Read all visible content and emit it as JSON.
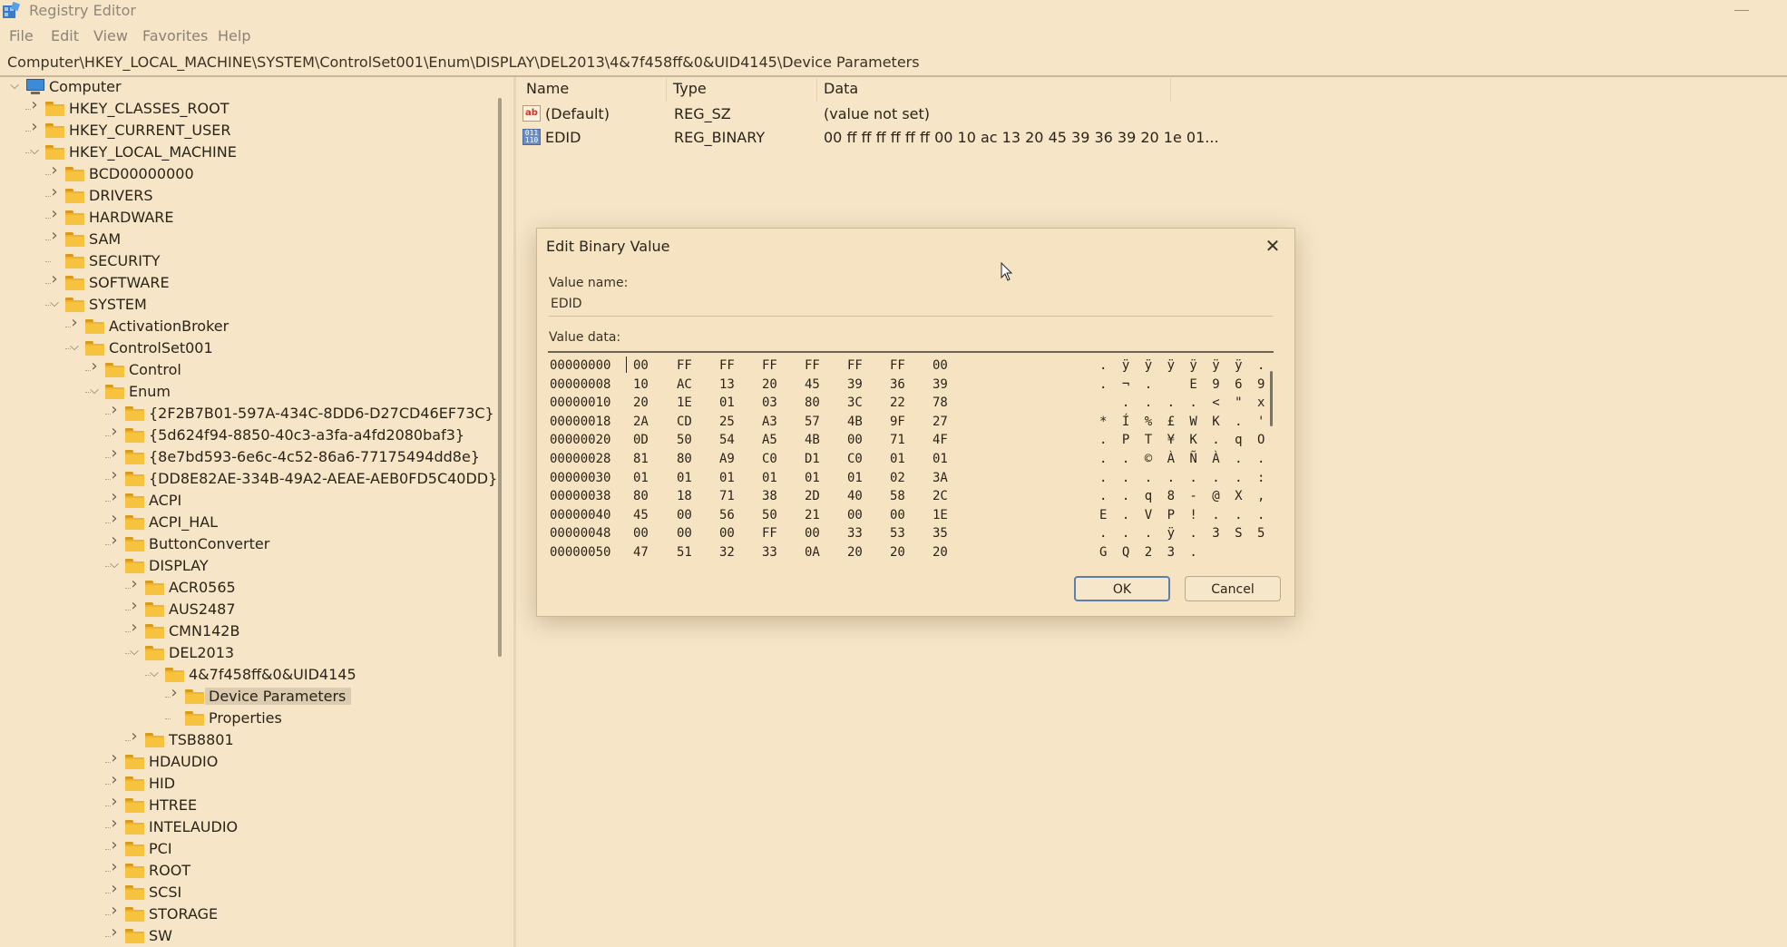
{
  "window": {
    "title": "Registry Editor",
    "app_icon": "registry-icon"
  },
  "menu": [
    "File",
    "Edit",
    "View",
    "Favorites",
    "Help"
  ],
  "address": "Computer\\HKEY_LOCAL_MACHINE\\SYSTEM\\ControlSet001\\Enum\\DISPLAY\\DEL2013\\4&7f458ff&0&UID4145\\Device Parameters",
  "tree": [
    {
      "label": "Computer",
      "level": 0,
      "state": "expanded",
      "icon": "computer-icon"
    },
    {
      "label": "HKEY_CLASSES_ROOT",
      "level": 1,
      "state": "collapsed"
    },
    {
      "label": "HKEY_CURRENT_USER",
      "level": 1,
      "state": "collapsed"
    },
    {
      "label": "HKEY_LOCAL_MACHINE",
      "level": 1,
      "state": "expanded"
    },
    {
      "label": "BCD00000000",
      "level": 2,
      "state": "collapsed"
    },
    {
      "label": "DRIVERS",
      "level": 2,
      "state": "collapsed"
    },
    {
      "label": "HARDWARE",
      "level": 2,
      "state": "collapsed"
    },
    {
      "label": "SAM",
      "level": 2,
      "state": "collapsed"
    },
    {
      "label": "SECURITY",
      "level": 2,
      "state": "leaf"
    },
    {
      "label": "SOFTWARE",
      "level": 2,
      "state": "collapsed"
    },
    {
      "label": "SYSTEM",
      "level": 2,
      "state": "expanded"
    },
    {
      "label": "ActivationBroker",
      "level": 3,
      "state": "collapsed"
    },
    {
      "label": "ControlSet001",
      "level": 3,
      "state": "expanded"
    },
    {
      "label": "Control",
      "level": 4,
      "state": "collapsed"
    },
    {
      "label": "Enum",
      "level": 4,
      "state": "expanded"
    },
    {
      "label": "{2F2B7B01-597A-434C-8DD6-D27CD46EF73C}",
      "level": 5,
      "state": "collapsed"
    },
    {
      "label": "{5d624f94-8850-40c3-a3fa-a4fd2080baf3}",
      "level": 5,
      "state": "collapsed"
    },
    {
      "label": "{8e7bd593-6e6c-4c52-86a6-77175494dd8e}",
      "level": 5,
      "state": "collapsed"
    },
    {
      "label": "{DD8E82AE-334B-49A2-AEAE-AEB0FD5C40DD}",
      "level": 5,
      "state": "collapsed"
    },
    {
      "label": "ACPI",
      "level": 5,
      "state": "collapsed"
    },
    {
      "label": "ACPI_HAL",
      "level": 5,
      "state": "collapsed"
    },
    {
      "label": "ButtonConverter",
      "level": 5,
      "state": "collapsed"
    },
    {
      "label": "DISPLAY",
      "level": 5,
      "state": "expanded"
    },
    {
      "label": "ACR0565",
      "level": 6,
      "state": "collapsed"
    },
    {
      "label": "AUS2487",
      "level": 6,
      "state": "collapsed"
    },
    {
      "label": "CMN142B",
      "level": 6,
      "state": "collapsed"
    },
    {
      "label": "DEL2013",
      "level": 6,
      "state": "expanded"
    },
    {
      "label": "4&7f458ff&0&UID4145",
      "level": 7,
      "state": "expanded"
    },
    {
      "label": "Device Parameters",
      "level": 8,
      "state": "collapsed",
      "selected": true
    },
    {
      "label": "Properties",
      "level": 8,
      "state": "leaf"
    },
    {
      "label": "TSB8801",
      "level": 6,
      "state": "collapsed"
    },
    {
      "label": "HDAUDIO",
      "level": 5,
      "state": "collapsed"
    },
    {
      "label": "HID",
      "level": 5,
      "state": "collapsed"
    },
    {
      "label": "HTREE",
      "level": 5,
      "state": "collapsed"
    },
    {
      "label": "INTELAUDIO",
      "level": 5,
      "state": "collapsed"
    },
    {
      "label": "PCI",
      "level": 5,
      "state": "collapsed"
    },
    {
      "label": "ROOT",
      "level": 5,
      "state": "collapsed"
    },
    {
      "label": "SCSI",
      "level": 5,
      "state": "collapsed"
    },
    {
      "label": "STORAGE",
      "level": 5,
      "state": "collapsed"
    },
    {
      "label": "SW",
      "level": 5,
      "state": "collapsed"
    }
  ],
  "list": {
    "columns": [
      "Name",
      "Type",
      "Data"
    ],
    "rows": [
      {
        "name": "(Default)",
        "type": "REG_SZ",
        "data": "(value not set)",
        "icon": "string-value-icon"
      },
      {
        "name": "EDID",
        "type": "REG_BINARY",
        "data": "00 ff ff ff ff ff ff 00 10 ac 13 20 45 39 36 39 20 1e 01...",
        "icon": "binary-value-icon"
      }
    ]
  },
  "dialog": {
    "title": "Edit Binary Value",
    "value_name_label": "Value name:",
    "value_name": "EDID",
    "value_data_label": "Value data:",
    "ok": "OK",
    "cancel": "Cancel",
    "hex_rows": [
      {
        "addr": "00000000",
        "bytes": [
          "00",
          "FF",
          "FF",
          "FF",
          "FF",
          "FF",
          "FF",
          "00"
        ],
        "ascii": ". ÿ ÿ ÿ ÿ ÿ ÿ ."
      },
      {
        "addr": "00000008",
        "bytes": [
          "10",
          "AC",
          "13",
          "20",
          "45",
          "39",
          "36",
          "39"
        ],
        "ascii": ". ¬ .   E 9 6 9"
      },
      {
        "addr": "00000010",
        "bytes": [
          "20",
          "1E",
          "01",
          "03",
          "80",
          "3C",
          "22",
          "78"
        ],
        "ascii": "  . . . . < \" x"
      },
      {
        "addr": "00000018",
        "bytes": [
          "2A",
          "CD",
          "25",
          "A3",
          "57",
          "4B",
          "9F",
          "27"
        ],
        "ascii": "* Í % £ W K . '"
      },
      {
        "addr": "00000020",
        "bytes": [
          "0D",
          "50",
          "54",
          "A5",
          "4B",
          "00",
          "71",
          "4F"
        ],
        "ascii": ". P T ¥ K . q O"
      },
      {
        "addr": "00000028",
        "bytes": [
          "81",
          "80",
          "A9",
          "C0",
          "D1",
          "C0",
          "01",
          "01"
        ],
        "ascii": ". . © À Ñ À . ."
      },
      {
        "addr": "00000030",
        "bytes": [
          "01",
          "01",
          "01",
          "01",
          "01",
          "01",
          "02",
          "3A"
        ],
        "ascii": ". . . . . . . :"
      },
      {
        "addr": "00000038",
        "bytes": [
          "80",
          "18",
          "71",
          "38",
          "2D",
          "40",
          "58",
          "2C"
        ],
        "ascii": ". . q 8 - @ X ,"
      },
      {
        "addr": "00000040",
        "bytes": [
          "45",
          "00",
          "56",
          "50",
          "21",
          "00",
          "00",
          "1E"
        ],
        "ascii": "E . V P ! . . ."
      },
      {
        "addr": "00000048",
        "bytes": [
          "00",
          "00",
          "00",
          "FF",
          "00",
          "33",
          "53",
          "35"
        ],
        "ascii": ". . . ÿ . 3 S 5"
      },
      {
        "addr": "00000050",
        "bytes": [
          "47",
          "51",
          "32",
          "33",
          "0A",
          "20",
          "20",
          "20"
        ],
        "ascii": "G Q 2 3 .      "
      }
    ]
  }
}
